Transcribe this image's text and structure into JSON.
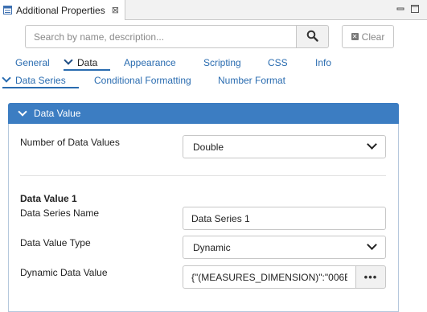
{
  "view": {
    "title": "Additional Properties",
    "close_glyph": "⊠",
    "icons": {
      "tab": "properties-icon",
      "minimize": "minimize-icon",
      "maximize": "maximize-icon"
    }
  },
  "search": {
    "placeholder": "Search by name, description...",
    "value": "",
    "button_icon": "search-icon",
    "clear_label": "Clear"
  },
  "tabs": [
    {
      "label": "General"
    },
    {
      "label": "Data",
      "active": true
    },
    {
      "label": "Appearance"
    },
    {
      "label": "Scripting"
    },
    {
      "label": "CSS"
    },
    {
      "label": "Info"
    }
  ],
  "subtabs": [
    {
      "label": "Data Series",
      "active": true
    },
    {
      "label": "Conditional Formatting"
    },
    {
      "label": "Number Format"
    }
  ],
  "panel": {
    "title": "Data Value",
    "number_of_values": {
      "label": "Number of Data Values",
      "value": "Double"
    },
    "section_title": "Data Value 1",
    "series_name": {
      "label": "Data Series Name",
      "value": "Data Series 1"
    },
    "value_type": {
      "label": "Data Value Type",
      "value": "Dynamic"
    },
    "dynamic_value": {
      "label": "Dynamic Data Value",
      "value": "{\"(MEASURES_DIMENSION)\":\"006E",
      "button_label": "•••"
    }
  },
  "colors": {
    "accent": "#3c7dc2",
    "link": "#2a6cb0"
  }
}
